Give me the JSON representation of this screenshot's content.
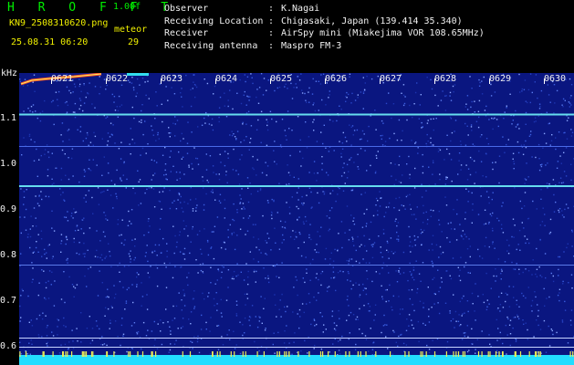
{
  "header": {
    "app_title": "H R O F F T",
    "app_version": "1.00f",
    "file_name": "KN9_2508310620.png",
    "meteor_label": "meteor",
    "meteor_count": "29",
    "datetime": "25.08.31 06:20"
  },
  "info": [
    {
      "key": "Observer",
      "value": "K.Nagai"
    },
    {
      "key": "Receiving Location",
      "value": "Chigasaki, Japan (139.414 35.340)"
    },
    {
      "key": "Receiver",
      "value": "AirSpy mini (Miakejima VOR 108.65MHz)"
    },
    {
      "key": "Receiving antenna",
      "value": "Maspro FM-3"
    }
  ],
  "axis": {
    "unit": "kHz",
    "y_ticks": [
      "1.1",
      "1.0",
      "0.9",
      "0.8",
      "0.7",
      "0.6"
    ],
    "x_ticks": [
      "0621",
      "0622",
      "0623",
      "0624",
      "0625",
      "0626",
      "0627",
      "0628",
      "0629",
      "0630"
    ]
  },
  "colors": {
    "background": "#0a1680",
    "carrier": "#66ddee",
    "meteor_echo": "#ff5522",
    "baseline": "#22ddff"
  }
}
